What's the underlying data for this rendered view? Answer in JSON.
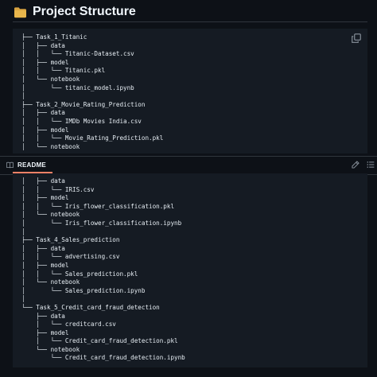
{
  "section": {
    "icon": "folder-icon",
    "title": "Project Structure"
  },
  "tree_top": [
    "├── Task_1_Titanic",
    "│   ├── data",
    "│   │   └── Titanic-Dataset.csv",
    "│   ├── model",
    "│   │   └── Titanic.pkl",
    "│   └── notebook",
    "│       └── titanic_model.ipynb",
    "│",
    "├── Task_2_Movie_Rating_Prediction",
    "│   ├── data",
    "│   │   └── IMDb Movies India.csv",
    "│   ├── model",
    "│   │   └── Movie_Rating_Prediction.pkl",
    "│   └── notebook"
  ],
  "tree_bottom": [
    "│   ├── data",
    "│   │   └── IRIS.csv",
    "│   ├── model",
    "│   │   └── Iris_flower_classification.pkl",
    "│   └── notebook",
    "│       └── Iris_flower_classification.ipynb",
    "│",
    "├── Task_4_Sales_prediction",
    "│   ├── data",
    "│   │   └── advertising.csv",
    "│   ├── model",
    "│   │   └── Sales_prediction.pkl",
    "│   └── notebook",
    "│       └── Sales_prediction.ipynb",
    "│",
    "└── Task_5_Credit_card_fraud_detection",
    "    ├── data",
    "    │   └── creditcard.csv",
    "    ├── model",
    "    │   └── Credit_card_fraud_detection.pkl",
    "    └── notebook",
    "        └── Credit_card_fraud_detection.ipynb"
  ],
  "toolbar": {
    "readme_label": "README",
    "book_icon": "book-icon",
    "edit_icon": "pencil-icon",
    "outline_icon": "list-icon",
    "copy_icon": "copy-icon"
  },
  "colors": {
    "background": "#0d1117",
    "code_background": "#151b23",
    "text": "#e6edf3",
    "folder": "#d9a441",
    "tab_accent": "#f78166",
    "border": "#30363d",
    "muted": "#8b949e"
  }
}
